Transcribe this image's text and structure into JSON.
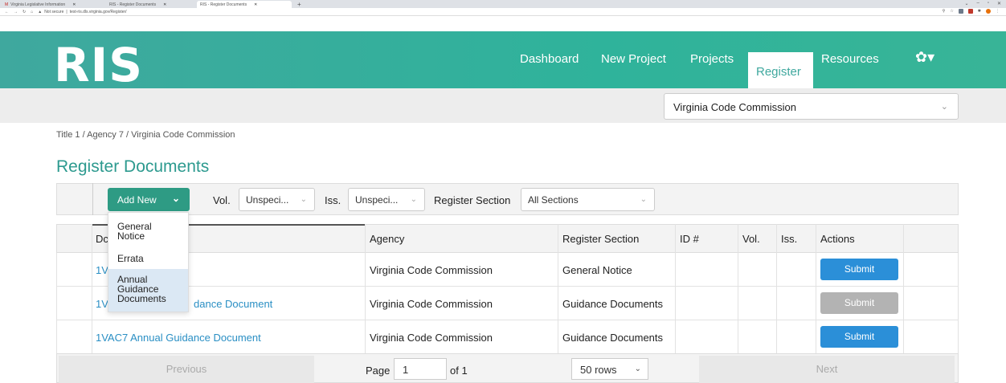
{
  "browser": {
    "tabs": [
      {
        "label": "Virginia Legislative Information"
      },
      {
        "label": "RIS - Register Documents"
      },
      {
        "label": "RIS - Register Documents"
      }
    ],
    "security": "Not secure",
    "url": "test-ris.dls.virginia.gov/Register/"
  },
  "header": {
    "logo": "RIS",
    "nav": [
      "Dashboard",
      "New Project",
      "Projects",
      "Register",
      "Resources"
    ],
    "active_nav": "Register",
    "settings_icon": "gear-icon",
    "brand_color": "#3fa89e"
  },
  "agency_select": {
    "value": "Virginia Code Commission"
  },
  "breadcrumb": "Title 1 / Agency 7 / Virginia Code Commission",
  "page_title": "Register Documents",
  "filters": {
    "add_new": "Add New",
    "vol_label": "Vol.",
    "vol_value": "Unspeci...",
    "iss_label": "Iss.",
    "iss_value": "Unspeci...",
    "section_label": "Register Section",
    "section_value": "All Sections"
  },
  "dropdown": {
    "items": [
      "General\nNotice",
      "Errata",
      "Annual\nGuidance\nDocuments"
    ]
  },
  "table": {
    "headers": [
      "Dc",
      "Agency",
      "Register Section",
      "ID #",
      "Vol.",
      "Iss.",
      "Actions"
    ],
    "rows": [
      {
        "document": "1V",
        "agency": "Virginia Code Commission",
        "section": "General Notice",
        "action": "Submit",
        "enabled": true
      },
      {
        "document": "1V",
        "document_tail": "dance Document",
        "agency": "Virginia Code Commission",
        "section": "Guidance Documents",
        "action": "Submit",
        "enabled": false
      },
      {
        "document": "1VAC7 Annual Guidance Document",
        "agency": "Virginia Code Commission",
        "section": "Guidance Documents",
        "action": "Submit",
        "enabled": true
      }
    ]
  },
  "pager": {
    "previous": "Previous",
    "page_label": "Page",
    "page_value": "1",
    "of_label": "of 1",
    "rows_value": "50 rows",
    "next": "Next"
  }
}
